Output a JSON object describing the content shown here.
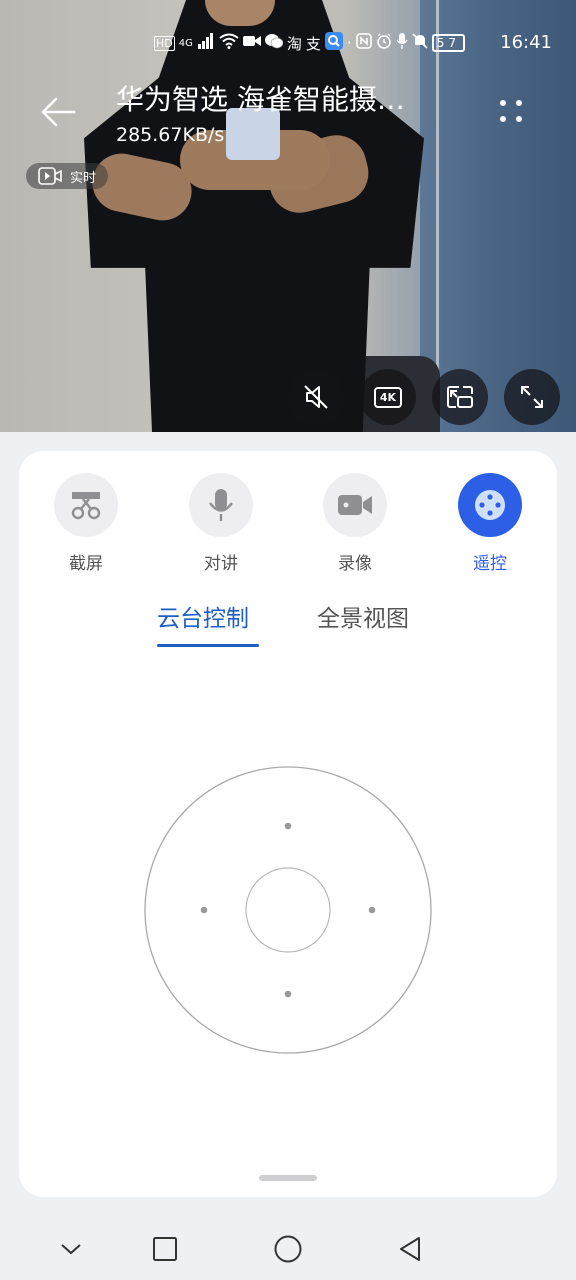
{
  "status_bar": {
    "time": "16:41",
    "battery": "57",
    "network": "4G"
  },
  "header": {
    "title": "华为智选 海雀智能摄…",
    "speed": "285.67KB/s",
    "live_label": "实时"
  },
  "video_controls": {
    "quality_label": "4K"
  },
  "tools": [
    {
      "label": "截屏",
      "icon": "screenshot-scissors-icon"
    },
    {
      "label": "对讲",
      "icon": "microphone-icon"
    },
    {
      "label": "录像",
      "icon": "video-camera-icon"
    },
    {
      "label": "遥控",
      "icon": "remote-control-icon",
      "active": true
    }
  ],
  "tabs": [
    {
      "label": "云台控制",
      "active": true
    },
    {
      "label": "全景视图",
      "active": false
    }
  ],
  "colors": {
    "accent": "#2c5fe6",
    "tab_active": "#1f5ec4",
    "background": "#eff0f3"
  }
}
